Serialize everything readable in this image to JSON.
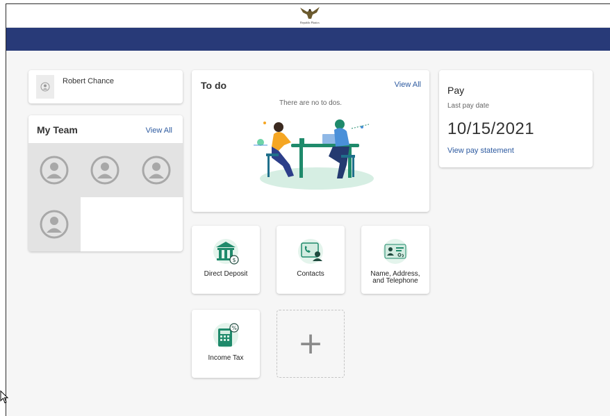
{
  "header": {
    "logo_text": "Republic Plastics"
  },
  "profile": {
    "name": "Robert Chance"
  },
  "team": {
    "title": "My Team",
    "view_all": "View All"
  },
  "todo": {
    "title": "To do",
    "view_all": "View All",
    "empty_message": "There are no to dos."
  },
  "pay": {
    "title": "Pay",
    "last_pay_label": "Last pay date",
    "last_pay_date": "10/15/2021",
    "statement_link": "View pay statement"
  },
  "tiles": [
    {
      "label": "Direct Deposit",
      "icon": "bank-dollar-icon"
    },
    {
      "label": "Contacts",
      "icon": "contacts-phone-icon"
    },
    {
      "label": "Name, Address, and Telephone",
      "icon": "id-card-icon"
    },
    {
      "label": "Income Tax",
      "icon": "calculator-percent-icon"
    }
  ],
  "add_tile": {
    "label": "+"
  },
  "colors": {
    "nav_band": "#283a78",
    "link": "#2d5aa0",
    "accent_green": "#1f8a6b"
  }
}
